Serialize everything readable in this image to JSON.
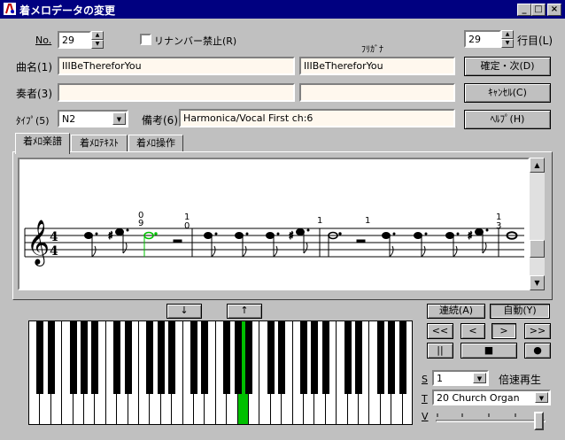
{
  "window": {
    "title": "着メロデータの変更",
    "minimize": "_",
    "maximize": "□",
    "close": "×"
  },
  "form": {
    "no_label": "No.",
    "no_value": "29",
    "rinnpa_label": "リナンバー禁止(R)",
    "row_value": "29",
    "row_label": "行目(L)",
    "furigana_label": "ﾌﾘｶﾞﾅ",
    "song_label": "曲名(1)",
    "song_value": "IIIBeThereforYou",
    "song_furigana": "IIIBeThereforYou",
    "player_label": "奏者(3)",
    "player_value": "",
    "player_furigana": "",
    "type_label": "ﾀｲﾌﾟ(5)",
    "type_value": "N2",
    "remark_label": "備考(6)",
    "remark_value": "Harmonica/Vocal First ch:6"
  },
  "buttons": {
    "ok": "確定・次(D)",
    "cancel": "ｷｬﾝｾﾙ(C)",
    "help": "ﾍﾙﾌﾟ(H)"
  },
  "tabs": [
    {
      "label": "着ﾒﾛ楽譜"
    },
    {
      "label": "着ﾒﾛﾃｷｽﾄ"
    },
    {
      "label": "着ﾒﾛ操作"
    }
  ],
  "score": {
    "time_top": "4",
    "time_bottom": "4",
    "fingerings": [
      "0",
      "9",
      "1",
      "0",
      "1",
      "1",
      "1",
      "3"
    ]
  },
  "controls": {
    "down": "↓",
    "up": "↑",
    "continuous": "連続(A)",
    "auto": "自動(Y)",
    "first": "<<",
    "prev": "<",
    "next": ">",
    "last": ">>",
    "pause": "||",
    "stop": "■",
    "record": "●",
    "s_label": "S",
    "s_value": "1",
    "speed_label": "倍速再生",
    "t_label": "T",
    "t_value": "20 Church Organ",
    "v_label": "V"
  },
  "piano": {
    "highlight_color": "#00c000"
  }
}
